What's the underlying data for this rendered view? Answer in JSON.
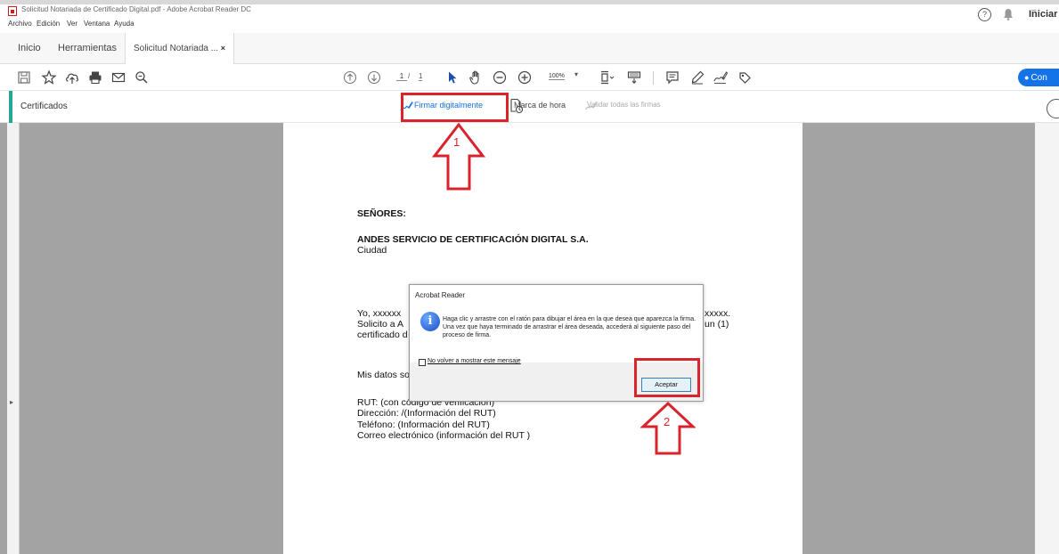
{
  "window": {
    "title": "Solicitud Notariada de Certificado Digital.pdf - Adobe Acrobat Reader DC",
    "minimize": "–"
  },
  "menu": [
    "Archivo",
    "Edición",
    "Ver",
    "Ventana",
    "Ayuda"
  ],
  "tabs": {
    "home": "Inicio",
    "tools": "Herramientas",
    "document": "Solicitud Notariada ...",
    "close": "×"
  },
  "header": {
    "help": "?",
    "sign_in": "Iniciar"
  },
  "toolbar": {
    "page_current": "1",
    "page_sep": "/",
    "page_total": "1",
    "zoom": "100%",
    "zoom_caret": "▾",
    "share_label": "Con"
  },
  "certificates_bar": {
    "title": "Certificados",
    "sign_digitally": "Firmar digitalmente",
    "timestamp": "Marca de hora",
    "validate_all": "Validar todas las firmas"
  },
  "document": {
    "salutation": "SEÑORES:",
    "company": "ANDES SERVICIO DE CERTIFICACIÓN DIGITAL S.A.",
    "city": "Ciudad",
    "line_yo": "Yo,  xxxxxx",
    "line_yo_end": "xxxxx.",
    "line_solicito": "Solicito a A",
    "line_solicito_end": "un (1)",
    "line_certificado": "certificado d",
    "line_mis_datos": "Mis datos so",
    "rut": "RUT: (con código de verificación)",
    "direccion": "Dirección: /(Información del RUT)",
    "telefono": "Teléfono: (Información del RUT)",
    "correo": "Correo electrónico (información del RUT )"
  },
  "dialog": {
    "title": "Acrobat Reader",
    "icon": "i",
    "message": "Haga clic y arrastre con el ratón para dibujar el área en la que desea que aparezca la firma. Una vez que haya terminado de arrastrar el área deseada, accederá al siguiente paso del proceso de firma.",
    "checkbox_label": "No volver a mostrar este mensaje",
    "accept": "Aceptar"
  },
  "annotations": {
    "step1": "1",
    "step2": "2",
    "color": "#d9232d"
  },
  "colors": {
    "accent_blue": "#1473e6",
    "teal_accent": "#26a69a",
    "doc_background": "#a3a3a3"
  }
}
